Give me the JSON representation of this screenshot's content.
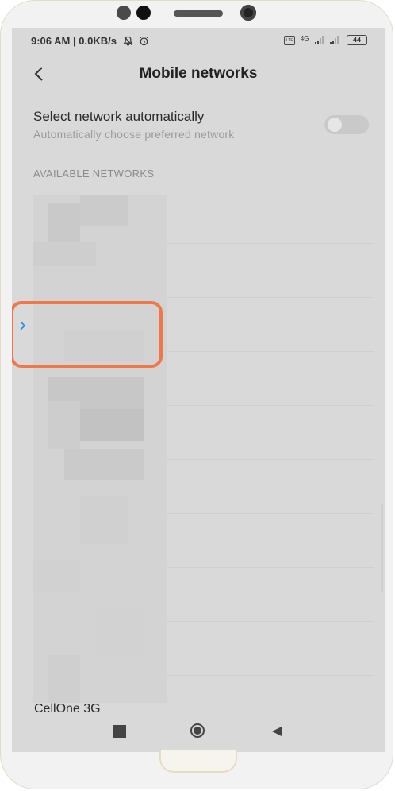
{
  "status_bar": {
    "time": "9:06 AM",
    "separator": "|",
    "speed": "0.0KB/s",
    "signal_label": "4G",
    "lte_label": "LTE",
    "battery": "44"
  },
  "header": {
    "title": "Mobile networks",
    "back_icon": "chevron-left-icon"
  },
  "auto_select": {
    "title": "Select network automatically",
    "subtitle": "Automatically choose preferred network",
    "enabled": false
  },
  "section": {
    "label": "AVAILABLE NETWORKS"
  },
  "networks": {
    "visible_partial_label": "CellOne 3G"
  },
  "nav_bar": {
    "recent_icon": "square-icon",
    "home_icon": "circle-icon",
    "back_icon": "triangle-back-icon"
  },
  "colors": {
    "highlight": "#f07848",
    "chevron": "#1f8fe0",
    "screen_bg": "#d9d9d9"
  }
}
